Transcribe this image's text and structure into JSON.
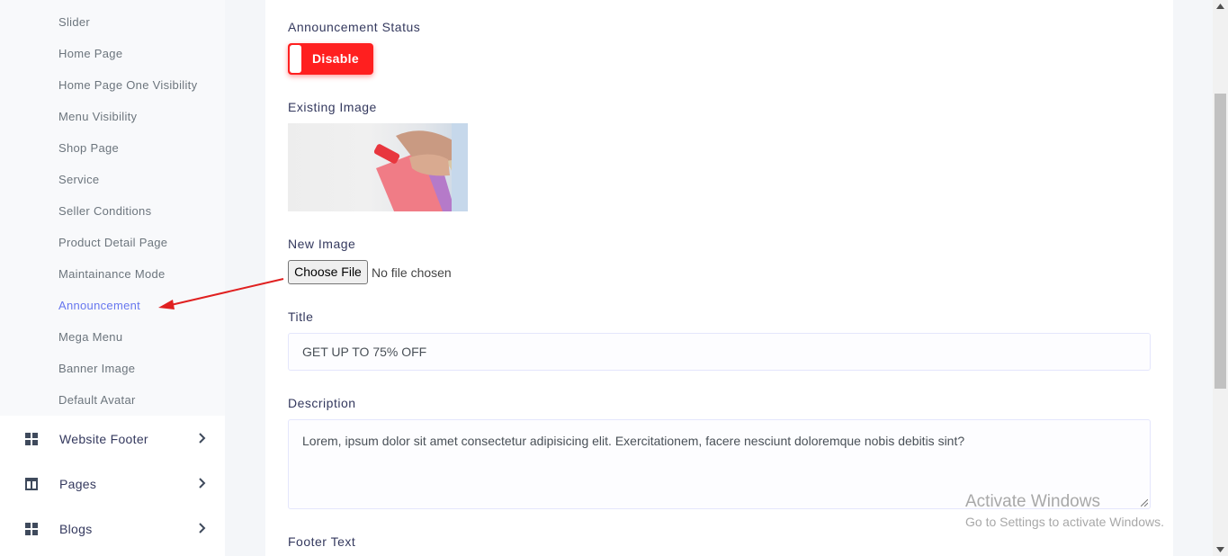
{
  "sidebar": {
    "submenu": [
      {
        "label": "Slider"
      },
      {
        "label": "Home Page"
      },
      {
        "label": "Home Page One Visibility"
      },
      {
        "label": "Menu Visibility"
      },
      {
        "label": "Shop Page"
      },
      {
        "label": "Service"
      },
      {
        "label": "Seller Conditions"
      },
      {
        "label": "Product Detail Page"
      },
      {
        "label": "Maintainance Mode"
      },
      {
        "label": "Announcement",
        "active": true
      },
      {
        "label": "Mega Menu"
      },
      {
        "label": "Banner Image"
      },
      {
        "label": "Default Avatar"
      }
    ],
    "menu": [
      {
        "label": "Website Footer",
        "icon": "grid-icon"
      },
      {
        "label": "Pages",
        "icon": "columns-icon"
      },
      {
        "label": "Blogs",
        "icon": "grid-icon"
      }
    ]
  },
  "form": {
    "status_label": "Announcement Status",
    "status_toggle": "Disable",
    "existing_image_label": "Existing Image",
    "new_image_label": "New Image",
    "choose_file": "Choose File",
    "no_file": "No file chosen",
    "title_label": "Title",
    "title_value": "GET UP TO 75% OFF",
    "description_label": "Description",
    "description_value": "Lorem, ipsum dolor sit amet consectetur adipisicing elit. Exercitationem, facere nesciunt doloremque nobis debitis sint?",
    "footer_text_label": "Footer Text"
  },
  "watermark": {
    "line1": "Activate Windows",
    "line2": "Go to Settings to activate Windows."
  },
  "colors": {
    "accent": "#6777ef",
    "toggle_off": "#ff1f1f",
    "annotation_arrow": "#e02020"
  }
}
